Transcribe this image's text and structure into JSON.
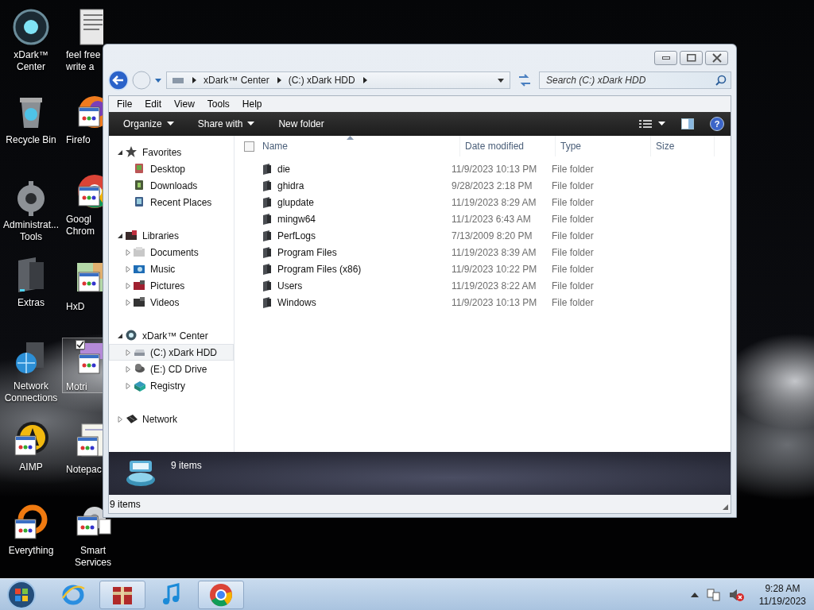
{
  "desktop": {
    "icons": [
      {
        "lines": [
          "xDark™",
          "Center"
        ],
        "kind": "orb",
        "selected": false,
        "cut": false
      },
      {
        "lines": [
          "feel free",
          "write a"
        ],
        "kind": "document",
        "selected": false,
        "cut": true
      },
      {
        "lines": [
          "Recycle Bin"
        ],
        "kind": "bin",
        "selected": false,
        "cut": false
      },
      {
        "lines": [
          "Firefo"
        ],
        "kind": "firefox",
        "selected": false,
        "cut": true
      },
      {
        "lines": [
          "Administrat...",
          "Tools"
        ],
        "kind": "gear",
        "selected": false,
        "cut": false
      },
      {
        "lines": [
          "Googl",
          "Chrom"
        ],
        "kind": "chrome",
        "selected": false,
        "cut": true
      },
      {
        "lines": [
          "Extras"
        ],
        "kind": "folder",
        "selected": false,
        "cut": false
      },
      {
        "lines": [
          "HxD"
        ],
        "kind": "hxd",
        "selected": false,
        "cut": true
      },
      {
        "lines": [
          "Network",
          "Connections"
        ],
        "kind": "globe",
        "selected": false,
        "cut": false
      },
      {
        "lines": [
          "Motri"
        ],
        "kind": "motri",
        "selected": true,
        "checked": true,
        "cut": true
      },
      {
        "lines": [
          "AIMP"
        ],
        "kind": "aimp",
        "selected": false,
        "cut": false
      },
      {
        "lines": [
          "Notepac"
        ],
        "kind": "notepad",
        "selected": false,
        "cut": true
      },
      {
        "lines": [
          "Everything"
        ],
        "kind": "everything",
        "selected": false,
        "cut": false
      },
      {
        "lines": [
          "Smart",
          "Services"
        ],
        "kind": "services",
        "selected": false,
        "cut": false
      }
    ]
  },
  "window": {
    "address": {
      "segments": [
        "xDark™ Center",
        "(C:) xDark HDD"
      ]
    },
    "search": {
      "placeholder": "Search (C:) xDark HDD"
    },
    "menu": [
      "File",
      "Edit",
      "View",
      "Tools",
      "Help"
    ],
    "toolbar": {
      "buttons": [
        {
          "label": "Organize",
          "dropdown": true
        },
        {
          "label": "Share with",
          "dropdown": true
        },
        {
          "label": "New folder",
          "dropdown": false
        }
      ],
      "help": "?"
    },
    "navigation": [
      {
        "label": "Favorites",
        "kind": "star",
        "expanded": true,
        "selected": false,
        "children": [
          {
            "label": "Desktop",
            "kind": "desktop",
            "selected": false
          },
          {
            "label": "Downloads",
            "kind": "downloads",
            "selected": false
          },
          {
            "label": "Recent Places",
            "kind": "recent",
            "selected": false
          }
        ]
      },
      {
        "label": "Libraries",
        "kind": "library",
        "expanded": true,
        "selected": false,
        "children": [
          {
            "label": "Documents",
            "kind": "documents",
            "expanded": false,
            "selected": false
          },
          {
            "label": "Music",
            "kind": "music",
            "expanded": false,
            "selected": false
          },
          {
            "label": "Pictures",
            "kind": "pictures",
            "expanded": false,
            "selected": false
          },
          {
            "label": "Videos",
            "kind": "videos",
            "expanded": false,
            "selected": false
          }
        ]
      },
      {
        "label": "xDark™ Center",
        "kind": "orb",
        "expanded": true,
        "selected": false,
        "children": [
          {
            "label": "(C:) xDark HDD",
            "kind": "drive",
            "expanded": false,
            "selected": true
          },
          {
            "label": "(E:) CD Drive",
            "kind": "cd",
            "expanded": false,
            "selected": false
          },
          {
            "label": "Registry",
            "kind": "registry",
            "expanded": false,
            "selected": false
          }
        ]
      },
      {
        "label": "Network",
        "kind": "network",
        "expanded": false,
        "selected": false
      }
    ],
    "files": {
      "select_all": {
        "checked": false
      },
      "columns": [
        {
          "label": "Name",
          "sorted": true
        },
        {
          "label": "Date modified",
          "sorted": false
        },
        {
          "label": "Type",
          "sorted": false
        },
        {
          "label": "Size",
          "sorted": false
        }
      ],
      "rows": [
        {
          "name": "die",
          "date": "11/9/2023 10:13 PM",
          "type": "File folder"
        },
        {
          "name": "ghidra",
          "date": "9/28/2023 2:18 PM",
          "type": "File folder"
        },
        {
          "name": "glupdate",
          "date": "11/19/2023 8:29 AM",
          "type": "File folder"
        },
        {
          "name": "mingw64",
          "date": "11/1/2023 6:43 AM",
          "type": "File folder"
        },
        {
          "name": "PerfLogs",
          "date": "7/13/2009 8:20 PM",
          "type": "File folder"
        },
        {
          "name": "Program Files",
          "date": "11/19/2023 8:39 AM",
          "type": "File folder"
        },
        {
          "name": "Program Files (x86)",
          "date": "11/9/2023 10:22 PM",
          "type": "File folder"
        },
        {
          "name": "Users",
          "date": "11/19/2023 8:22 AM",
          "type": "File folder"
        },
        {
          "name": "Windows",
          "date": "11/9/2023 10:13 PM",
          "type": "File folder"
        }
      ]
    },
    "details": {
      "text": "9 items"
    },
    "status_bar": "9 items"
  },
  "taskbar": {
    "buttons": [
      {
        "kind": "ie",
        "active": false
      },
      {
        "kind": "archive",
        "active": true
      },
      {
        "kind": "music",
        "active": false
      },
      {
        "kind": "chrome",
        "active": true
      }
    ],
    "clock": {
      "time": "9:28 AM",
      "date": "11/19/2023"
    }
  }
}
